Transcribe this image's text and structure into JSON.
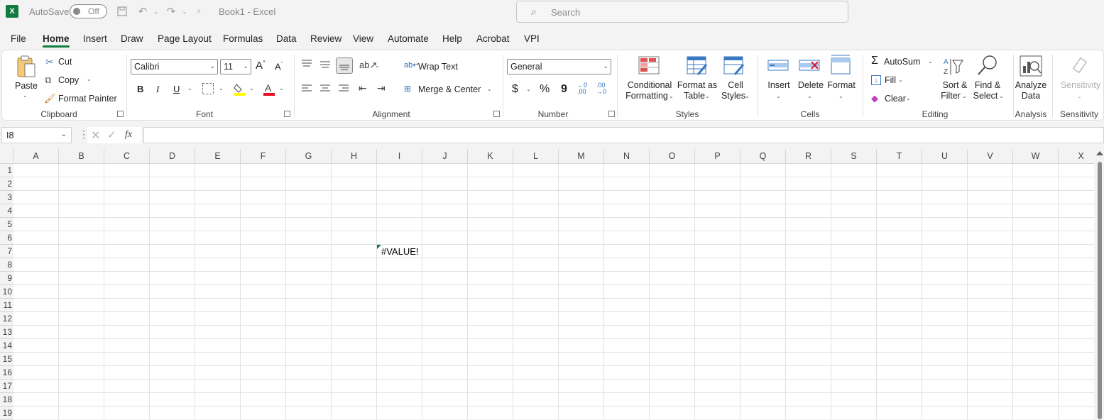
{
  "titlebar": {
    "autosave_label": "AutoSave",
    "toggle_state": "Off",
    "doc_title": "Book1  -  Excel",
    "search_placeholder": "Search"
  },
  "menu": {
    "tabs": [
      "File",
      "Home",
      "Insert",
      "Draw",
      "Page Layout",
      "Formulas",
      "Data",
      "Review",
      "View",
      "Automate",
      "Help",
      "Acrobat",
      "VPI"
    ],
    "active": "Home"
  },
  "ribbon": {
    "clipboard": {
      "paste": "Paste",
      "cut": "Cut",
      "copy": "Copy",
      "format_painter": "Format Painter",
      "label": "Clipboard"
    },
    "font": {
      "name": "Calibri",
      "size": "11",
      "bold": "B",
      "italic": "I",
      "underline": "U",
      "label": "Font",
      "font_color": "#e81123",
      "fill_color": "#ffff00"
    },
    "alignment": {
      "wrap_text": "Wrap Text",
      "merge_center": "Merge & Center",
      "label": "Alignment"
    },
    "number": {
      "format": "General",
      "currency": "$",
      "percent": "%",
      "comma": "9",
      "label": "Number"
    },
    "styles": {
      "conditional_1": "Conditional",
      "conditional_2": "Formatting",
      "format_table_1": "Format as",
      "format_table_2": "Table",
      "cell_styles_1": "Cell",
      "cell_styles_2": "Styles",
      "label": "Styles"
    },
    "cells": {
      "insert": "Insert",
      "delete": "Delete",
      "format": "Format",
      "label": "Cells"
    },
    "editing": {
      "autosum": "AutoSum",
      "fill": "Fill",
      "clear": "Clear",
      "sort_1": "Sort &",
      "sort_2": "Filter",
      "find_1": "Find &",
      "find_2": "Select",
      "label": "Editing"
    },
    "analysis": {
      "analyze_1": "Analyze",
      "analyze_2": "Data",
      "label": "Analysis"
    },
    "sensitivity": {
      "button": "Sensitivity",
      "label": "Sensitivity"
    }
  },
  "formula_bar": {
    "name_box": "I8",
    "fx": "fx",
    "formula": ""
  },
  "grid": {
    "columns": [
      "A",
      "B",
      "C",
      "D",
      "E",
      "F",
      "G",
      "H",
      "I",
      "J",
      "K",
      "L",
      "M",
      "N",
      "O",
      "P",
      "Q",
      "R",
      "S",
      "T",
      "U",
      "V",
      "W",
      "X"
    ],
    "rows": [
      "1",
      "2",
      "3",
      "4",
      "5",
      "6",
      "7",
      "8",
      "9",
      "10",
      "11",
      "12",
      "13",
      "14",
      "15",
      "16",
      "17",
      "18",
      "19"
    ],
    "cell_I7": "#VALUE!"
  },
  "colors": {
    "accent": "#107c41"
  }
}
